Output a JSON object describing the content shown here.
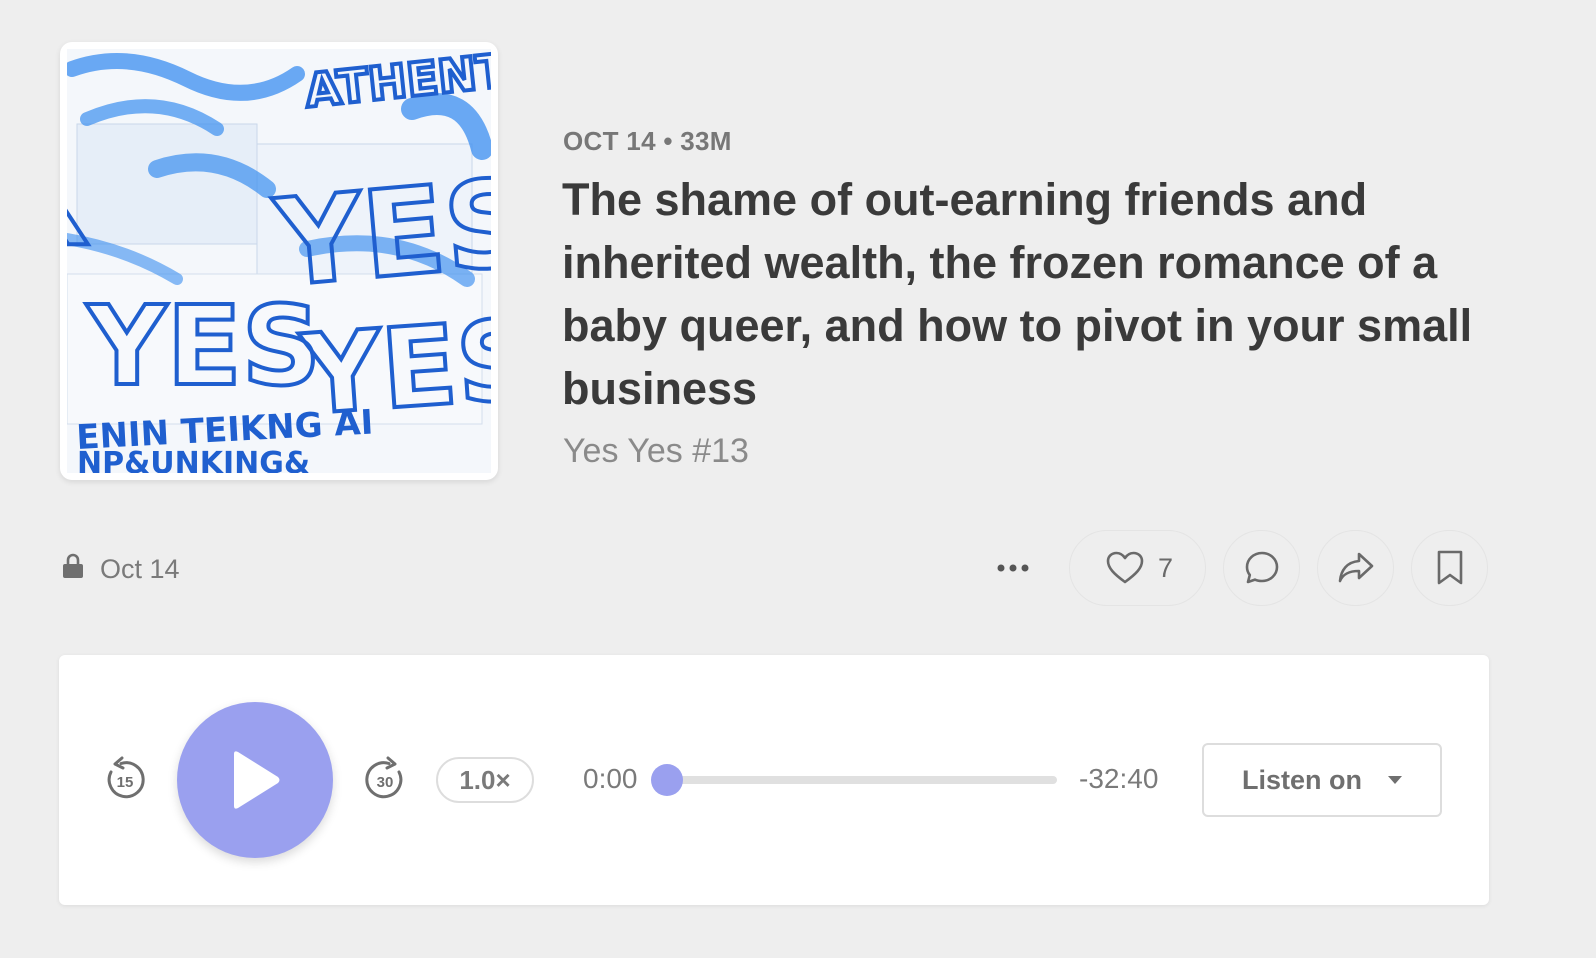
{
  "episode": {
    "meta": "OCT 14 • 33M",
    "title": "The shame of out-earning friends and inherited wealth, the frozen romance of a baby queer, and how to pivot in your small business",
    "subtitle": "Yes Yes #13",
    "cover": {
      "art_text": "YES YES YES YES",
      "ink_color": "#1f6fd6",
      "accent_color": "#3b8ef0"
    }
  },
  "post_bar": {
    "date": "Oct 14",
    "lock_icon": "lock-icon",
    "likes": "7",
    "icons": [
      "more-icon",
      "heart-icon",
      "comment-icon",
      "share-icon",
      "bookmark-icon"
    ]
  },
  "player": {
    "skip_back_label": "15",
    "skip_forward_label": "30",
    "speed": "1.0×",
    "current_time": "0:00",
    "remaining_time": "-32:40",
    "progress": 0,
    "listen_on_label": "Listen on",
    "accent_color": "#9aa0ef"
  }
}
